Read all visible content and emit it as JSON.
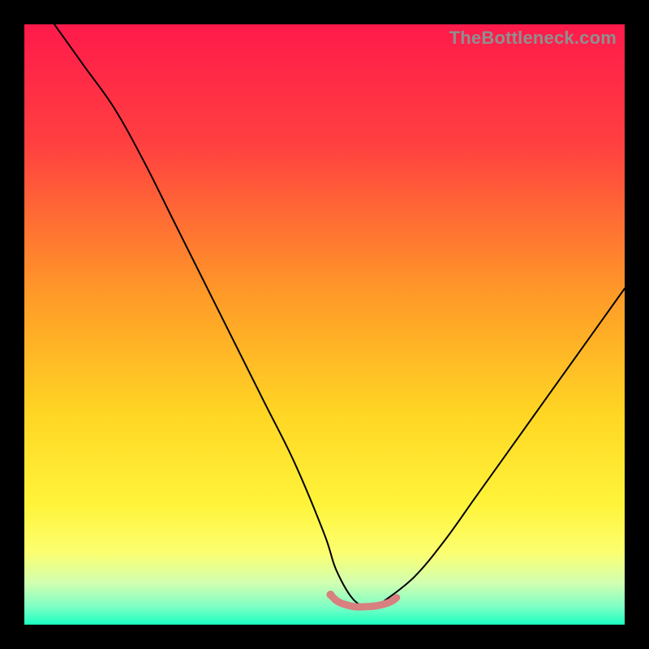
{
  "watermark": "TheBottleneck.com",
  "chart_data": {
    "type": "line",
    "title": "",
    "xlabel": "",
    "ylabel": "",
    "xlim": [
      0,
      100
    ],
    "ylim": [
      0,
      100
    ],
    "grid": false,
    "background_gradient_stops": [
      {
        "offset": 0.0,
        "color": "#ff1a4b"
      },
      {
        "offset": 0.2,
        "color": "#ff4040"
      },
      {
        "offset": 0.45,
        "color": "#ff9a28"
      },
      {
        "offset": 0.65,
        "color": "#ffd624"
      },
      {
        "offset": 0.8,
        "color": "#fff43a"
      },
      {
        "offset": 0.88,
        "color": "#fcff70"
      },
      {
        "offset": 0.93,
        "color": "#d2ffb0"
      },
      {
        "offset": 0.97,
        "color": "#7effc5"
      },
      {
        "offset": 1.0,
        "color": "#1bffc1"
      }
    ],
    "series": [
      {
        "name": "bottleneck-curve",
        "stroke": "#000000",
        "x": [
          5,
          10,
          15,
          20,
          25,
          30,
          35,
          40,
          45,
          50,
          52,
          55,
          58,
          60,
          65,
          70,
          75,
          80,
          85,
          90,
          95,
          100
        ],
        "y": [
          100,
          93,
          86,
          77,
          67,
          57,
          47,
          37,
          27,
          15,
          9,
          4,
          3,
          4,
          8,
          14,
          21,
          28,
          35,
          42,
          49,
          56
        ]
      },
      {
        "name": "optimal-zone-marker",
        "stroke": "#d87f7f",
        "x": [
          51,
          52,
          53,
          55,
          57,
          59,
          61,
          62
        ],
        "y": [
          5,
          4,
          3.5,
          3,
          3,
          3.2,
          3.8,
          4.5
        ]
      }
    ],
    "marker_dot": {
      "x": 51,
      "y": 5,
      "color": "#d87f7f",
      "r": 5
    }
  }
}
